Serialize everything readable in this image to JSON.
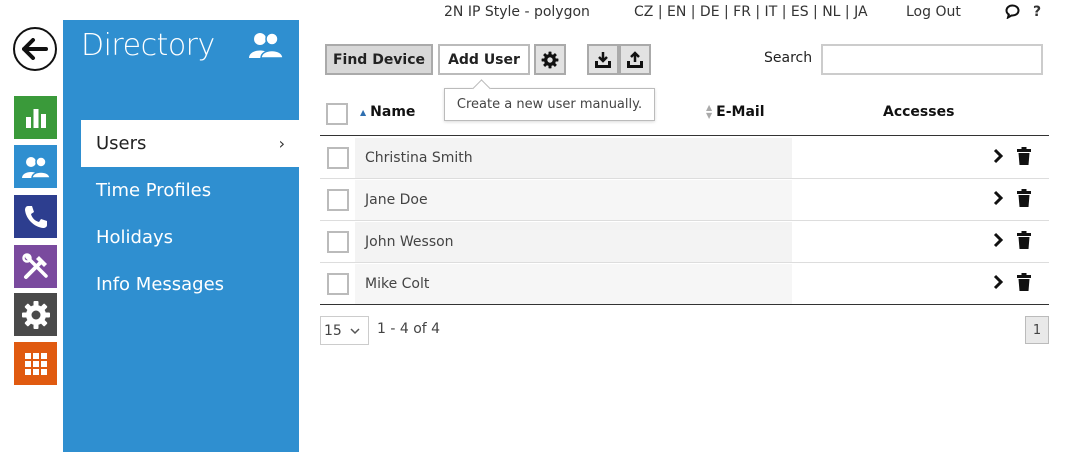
{
  "topbar": {
    "device_name": "2N IP Style - polygon",
    "languages": "CZ | EN | DE | FR | IT | ES | NL | JA",
    "logout": "Log Out",
    "help": "?"
  },
  "panel": {
    "title": "Directory",
    "nav": [
      {
        "label": "Users"
      },
      {
        "label": "Time Profiles"
      },
      {
        "label": "Holidays"
      },
      {
        "label": "Info Messages"
      }
    ]
  },
  "toolbar": {
    "find_device": "Find Device",
    "add_user": "Add User",
    "search_label": "Search",
    "search_value": ""
  },
  "tooltip": "Create a new user manually.",
  "table": {
    "headers": {
      "name": "Name",
      "email": "E-Mail",
      "accesses": "Accesses"
    },
    "rows": [
      {
        "name": "Christina Smith"
      },
      {
        "name": "Jane Doe"
      },
      {
        "name": "John Wesson"
      },
      {
        "name": "Mike Colt"
      }
    ]
  },
  "pagination": {
    "per_page": "15",
    "range": "1 - 4 of 4",
    "page": "1"
  },
  "colors": {
    "panel_blue": "#2f8fd0",
    "status_green": "#3a9a3a",
    "calls_navy": "#2d3e8f",
    "hardware_purple": "#7a4a9e",
    "services_gray": "#4a4a4a",
    "apps_orange": "#e05a10"
  }
}
